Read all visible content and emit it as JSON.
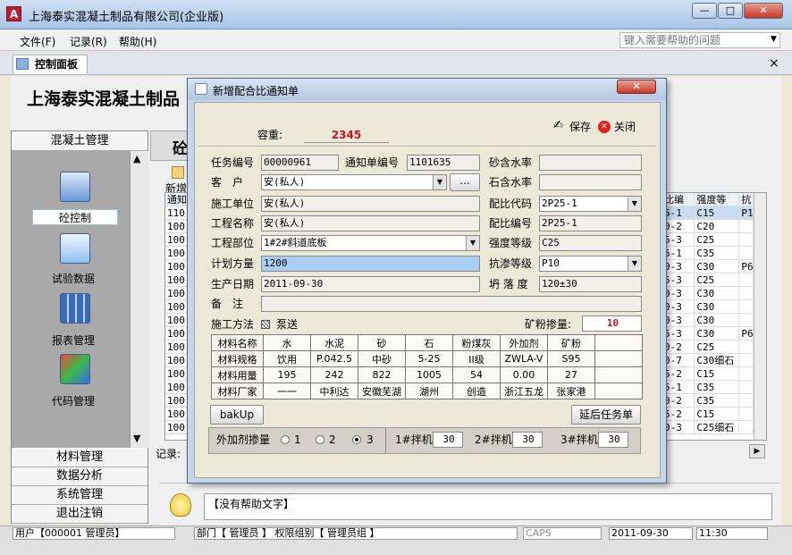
{
  "app": {
    "title": "上海泰实混凝土制品有限公司(企业版)",
    "icon_letter": "A"
  },
  "window_buttons": {
    "min": "—",
    "max": "□",
    "close": "✕"
  },
  "menu": {
    "items": [
      "文件(F)",
      "记录(R)",
      "帮助(H)"
    ],
    "help_placeholder": "键入需要帮助的问题"
  },
  "tab": {
    "label": "控制面板",
    "close": "×"
  },
  "main": {
    "title": "上海泰实混凝土制品",
    "section_heading": "砼",
    "new_label": "新增",
    "records_label": "记录:"
  },
  "left_panel": {
    "header": "混凝土管理",
    "nav": [
      {
        "label": "砼控制"
      },
      {
        "label": "试验数据"
      },
      {
        "label": "报表管理"
      },
      {
        "label": "代码管理"
      }
    ],
    "bottom_buttons": [
      "材料管理",
      "数据分析",
      "系统管理",
      "退出注销"
    ]
  },
  "bg_grid": {
    "header_left": "通知",
    "header_cols": [
      "比编",
      "强度等",
      "抗"
    ],
    "left_values": [
      "110",
      "100",
      "100",
      "100",
      "100",
      "100",
      "100",
      "100",
      "100",
      "100",
      "100",
      "100",
      "100",
      "100",
      "100",
      "100",
      "100"
    ],
    "rows": [
      [
        "5-1",
        "C15",
        "P1"
      ],
      [
        "0-2",
        "C20",
        ""
      ],
      [
        "5-3",
        "C25",
        ""
      ],
      [
        "5-1",
        "C35",
        ""
      ],
      [
        "0-3",
        "C30",
        "P6"
      ],
      [
        "5-3",
        "C25",
        ""
      ],
      [
        "0-3",
        "C30",
        ""
      ],
      [
        "0-3",
        "C30",
        ""
      ],
      [
        "0-3",
        "C30",
        ""
      ],
      [
        "5-3",
        "C30",
        "P6"
      ],
      [
        "0-2",
        "C25",
        ""
      ],
      [
        "0-7",
        "C30细石",
        ""
      ],
      [
        "5-2",
        "C15",
        ""
      ],
      [
        "5-1",
        "C35",
        ""
      ],
      [
        "0-2",
        "C35",
        ""
      ],
      [
        "5-2",
        "C15",
        ""
      ],
      [
        "0-3",
        "C25细石",
        ""
      ]
    ]
  },
  "help": {
    "text": "【没有帮助文字】"
  },
  "status": {
    "user": "用户【000001 管理员】",
    "dept": "部门【 管理员 】 权限组别【 管理员组 】",
    "caps": "CAPS",
    "date": "2011-09-30",
    "time": "11:30"
  },
  "dialog": {
    "title": "新增配合比通知单",
    "close": "✕",
    "capacity_label": "容重:",
    "capacity_value": "2345",
    "save_label": "保存",
    "close_label": "关闭",
    "fields": {
      "task_no_label": "任务编号",
      "task_no": "00000961",
      "notice_no_label": "通知单编号",
      "notice_no": "1101635",
      "sand_water_label": "砂含水率",
      "sand_water": "",
      "customer_label": "客　户",
      "customer": "安(私人)",
      "stone_water_label": "石含水率",
      "stone_water": "",
      "construct_unit_label": "施工单位",
      "construct_unit": "安(私人)",
      "mix_code_label": "配比代码",
      "mix_code": "2P25-1",
      "project_label": "工程名称",
      "project": "安(私人)",
      "mix_no_label": "配比编号",
      "mix_no": "2P25-1",
      "part_label": "工程部位",
      "part": "1#2#斜道底板",
      "strength_label": "强度等级",
      "strength": "C25",
      "plan_label": "计划方量",
      "plan": "1200",
      "impermeable_label": "抗渗等级",
      "impermeable": "P10",
      "date_label": "生产日期",
      "date": "2011-09-30",
      "slump_label": "坍 落 度",
      "slump": "120±30",
      "note_label": "备　注",
      "note": "",
      "method_label": "施工方法",
      "method_value": "泵送",
      "slag_label": "矿粉掺量:",
      "slag_value": "10",
      "ellipsis": "…"
    },
    "materials": {
      "rows": [
        [
          "材料名称",
          "水",
          "水泥",
          "砂",
          "石",
          "粉煤灰",
          "外加剂",
          "矿粉",
          ""
        ],
        [
          "材料规格",
          "饮用",
          "P.042.5",
          "中砂",
          "5-25",
          "II级",
          "ZWLA-V",
          "S95",
          ""
        ],
        [
          "材料用量",
          "195",
          "242",
          "822",
          "1005",
          "54",
          "0.00",
          "27",
          ""
        ],
        [
          "材料厂家",
          "一一",
          "中利达",
          "安徽芜湖",
          "湖州",
          "创造",
          "浙江五龙",
          "张家港",
          ""
        ]
      ]
    },
    "bakup_label": "bakUp",
    "delay_label": "延后任务单",
    "additive": {
      "label": "外加剂掺量",
      "options": [
        "1",
        "2",
        "3"
      ],
      "selected": "3"
    },
    "mixers": [
      {
        "label": "1#拌机",
        "value": "30"
      },
      {
        "label": "2#拌机",
        "value": "30"
      },
      {
        "label": "3#拌机",
        "value": "30"
      }
    ]
  }
}
